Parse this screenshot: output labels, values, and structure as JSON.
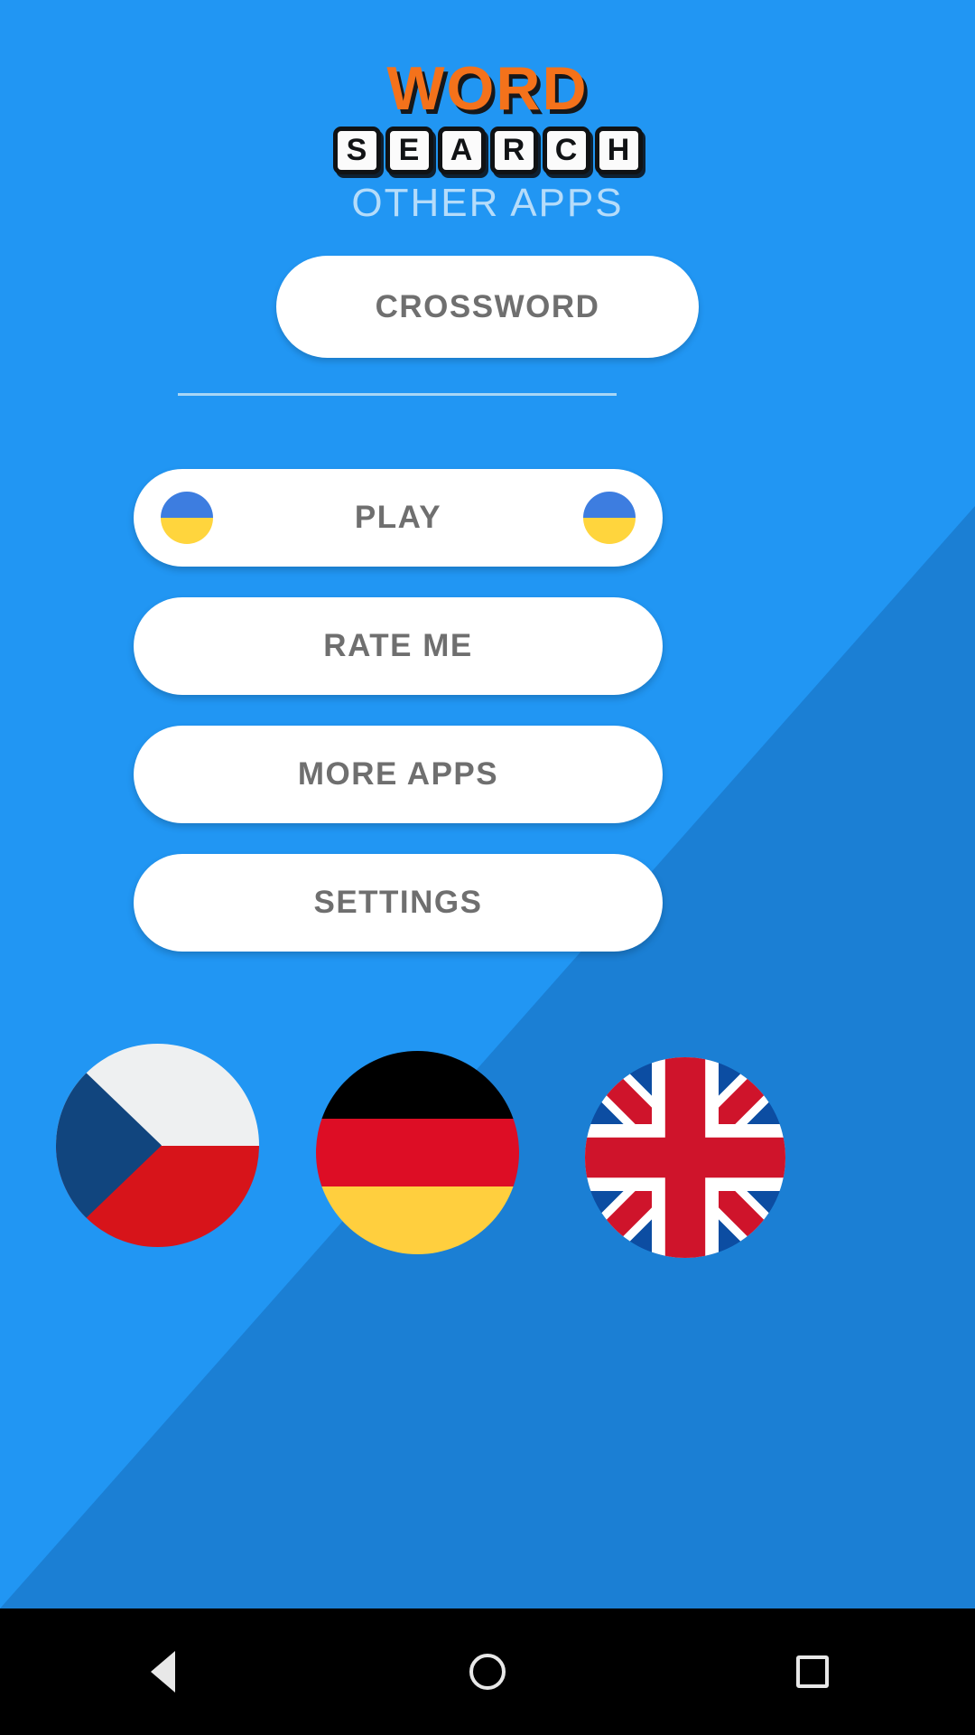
{
  "app": {
    "logo_top": "WORD",
    "logo_bottom_letters": [
      "S",
      "E",
      "A",
      "R",
      "C",
      "H"
    ],
    "logo_bottom": "SEARCH",
    "subtitle": "OTHER APPS",
    "background_color": "#2196f3",
    "background_shade_color": "#1b7fd4",
    "logo_word_color": "#f4721b",
    "subtitle_color": "#b5dcfa",
    "button_text_color": "#6f6f6f",
    "divider_color": "#a8d6f5"
  },
  "promo": {
    "crossword_label": "CROSSWORD"
  },
  "menu": {
    "items": [
      {
        "id": "play",
        "label": "PLAY",
        "has_flags": true,
        "flag": "ukraine-flag-icon"
      },
      {
        "id": "rate",
        "label": "RATE ME",
        "has_flags": false,
        "flag": ""
      },
      {
        "id": "more",
        "label": "MORE APPS",
        "has_flags": false,
        "flag": ""
      },
      {
        "id": "settings",
        "label": "SETTINGS",
        "has_flags": false,
        "flag": ""
      }
    ]
  },
  "languages": [
    {
      "id": "cz",
      "icon": "czech-flag-icon",
      "name": "Czech",
      "colors": [
        "#eef0f1",
        "#d7141a",
        "#11457e"
      ]
    },
    {
      "id": "de",
      "icon": "german-flag-icon",
      "name": "German",
      "colors": [
        "#000000",
        "#dd0d25",
        "#ffcf3e"
      ]
    },
    {
      "id": "gb",
      "icon": "uk-flag-icon",
      "name": "United Kingdom",
      "colors": [
        "#0c4da2",
        "#ffffff",
        "#cf142b"
      ]
    }
  ],
  "navbar": {
    "buttons": [
      {
        "id": "back",
        "icon": "back-triangle-icon"
      },
      {
        "id": "home",
        "icon": "home-circle-icon"
      },
      {
        "id": "recent",
        "icon": "recents-square-icon"
      }
    ],
    "background_color": "#000000"
  }
}
